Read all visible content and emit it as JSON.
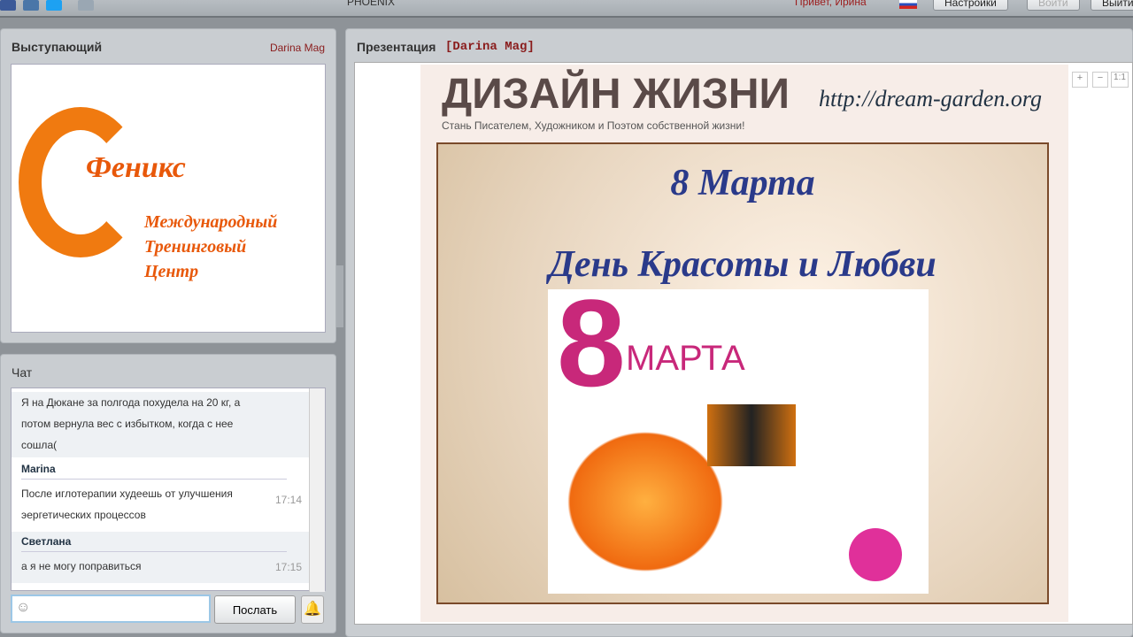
{
  "topbar": {
    "app_name": "PHOENIX",
    "greeting": "Привет, Ирина",
    "settings": "Настройки",
    "login": "Войти",
    "logout": "Выйти"
  },
  "speaker": {
    "title": "Выступающий",
    "name": "Darina Mag",
    "logo_text": [
      "Феникс",
      "Международный",
      "Тренинговый",
      "Центр"
    ]
  },
  "presentation": {
    "title": "Презентация",
    "presenter": "[Darina Mag]",
    "slide": {
      "header": "ДИЗАЙН ЖИЗНИ",
      "url": "http://dream-garden.org",
      "tagline": "Стань Писателем, Художником и Поэтом собственной жизни!",
      "line1": "8 Марта",
      "line2": "День Красоты и Любви",
      "card_number": "8",
      "card_word": "МАРТА"
    },
    "zoom": {
      "in": "+",
      "out": "−",
      "fit": "1:1"
    }
  },
  "chat": {
    "title": "Чат",
    "messages": [
      {
        "author": "",
        "text": "Я на Дюкане за полгода похудела на 20 кг, а потом вернула вес с избытком, когда с нее сошла(",
        "time": ""
      },
      {
        "author": "Marina",
        "text": "После иглотерапии худеешь от улучшения эергетических процессов",
        "time": "17:14"
      },
      {
        "author": "Светлана",
        "text": "а я не могу поправиться",
        "time": "17:15"
      }
    ],
    "input_value": "",
    "send": "Послать"
  }
}
